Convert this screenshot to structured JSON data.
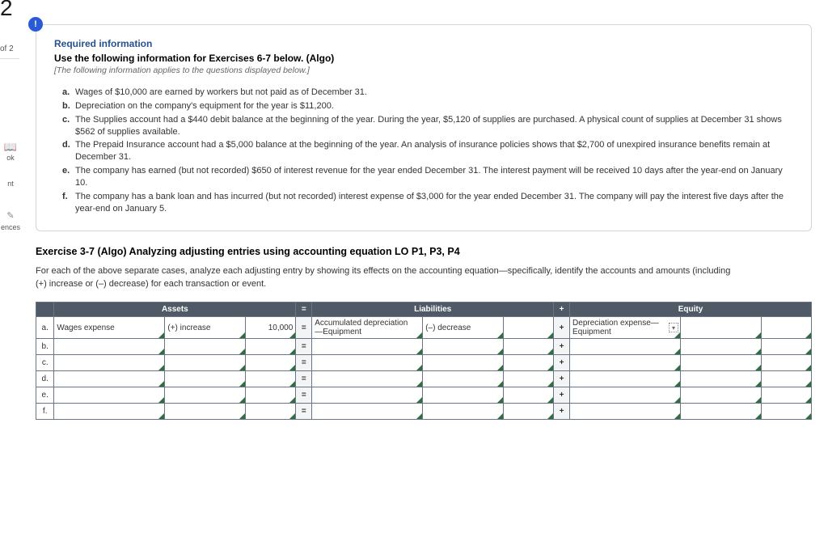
{
  "rail": {
    "big_number": "2",
    "of_text": "of 2",
    "book_label": "ok",
    "nt_label": "nt",
    "ences_label": "ences"
  },
  "card": {
    "required_heading": "Required information",
    "use_heading": "Use the following information for Exercises 6-7 below. (Algo)",
    "applies_note": "[The following information applies to the questions displayed below.]",
    "facts": [
      {
        "label": "a.",
        "text": "Wages of $10,000 are earned by workers but not paid as of December 31."
      },
      {
        "label": "b.",
        "text": "Depreciation on the company's equipment for the year is $11,200."
      },
      {
        "label": "c.",
        "text": "The Supplies account had a $440 debit balance at the beginning of the year. During the year, $5,120 of supplies are purchased. A physical count of supplies at December 31 shows $562 of supplies available."
      },
      {
        "label": "d.",
        "text": "The Prepaid Insurance account had a $5,000 balance at the beginning of the year. An analysis of insurance policies shows that $2,700 of unexpired insurance benefits remain at December 31."
      },
      {
        "label": "e.",
        "text": "The company has earned (but not recorded) $650 of interest revenue for the year ended December 31. The interest payment will be received 10 days after the year-end on January 10."
      },
      {
        "label": "f.",
        "text": "The company has a bank loan and has incurred (but not recorded) interest expense of $3,000 for the year ended December 31. The company will pay the interest five days after the year-end on January 5."
      }
    ]
  },
  "exercise": {
    "title": "Exercise 3-7 (Algo) Analyzing adjusting entries using accounting equation LO P1, P3, P4",
    "desc": "For each of the above separate cases, analyze each adjusting entry by showing its effects on the accounting equation—specifically, identify the accounts and amounts (including  (+) increase or (–) decrease) for each transaction or event."
  },
  "table": {
    "headers": {
      "assets": "Assets",
      "eq": "=",
      "liabilities": "Liabilities",
      "plus": "+",
      "equity": "Equity"
    },
    "rows": [
      {
        "idx": "a.",
        "asset_acct": "Wages expense",
        "asset_dir": "(+) increase",
        "asset_amt": "10,000",
        "liab_acct": "Accumulated depreciation\n—Equipment",
        "liab_dir": "(–) decrease",
        "liab_amt": "",
        "eq_acct": "Depreciation expense—Equipment",
        "eq_dir": "",
        "eq_amt": "",
        "show_dropdown": true
      },
      {
        "idx": "b.",
        "asset_acct": "",
        "asset_dir": "",
        "asset_amt": "",
        "liab_acct": "",
        "liab_dir": "",
        "liab_amt": "",
        "eq_acct": "",
        "eq_dir": "",
        "eq_amt": ""
      },
      {
        "idx": "c.",
        "asset_acct": "",
        "asset_dir": "",
        "asset_amt": "",
        "liab_acct": "",
        "liab_dir": "",
        "liab_amt": "",
        "eq_acct": "",
        "eq_dir": "",
        "eq_amt": ""
      },
      {
        "idx": "d.",
        "asset_acct": "",
        "asset_dir": "",
        "asset_amt": "",
        "liab_acct": "",
        "liab_dir": "",
        "liab_amt": "",
        "eq_acct": "",
        "eq_dir": "",
        "eq_amt": ""
      },
      {
        "idx": "e.",
        "asset_acct": "",
        "asset_dir": "",
        "asset_amt": "",
        "liab_acct": "",
        "liab_dir": "",
        "liab_amt": "",
        "eq_acct": "",
        "eq_dir": "",
        "eq_amt": ""
      },
      {
        "idx": "f.",
        "asset_acct": "",
        "asset_dir": "",
        "asset_amt": "",
        "liab_acct": "",
        "liab_dir": "",
        "liab_amt": "",
        "eq_acct": "",
        "eq_dir": "",
        "eq_amt": ""
      }
    ],
    "op_eq": "=",
    "op_plus": "+"
  }
}
